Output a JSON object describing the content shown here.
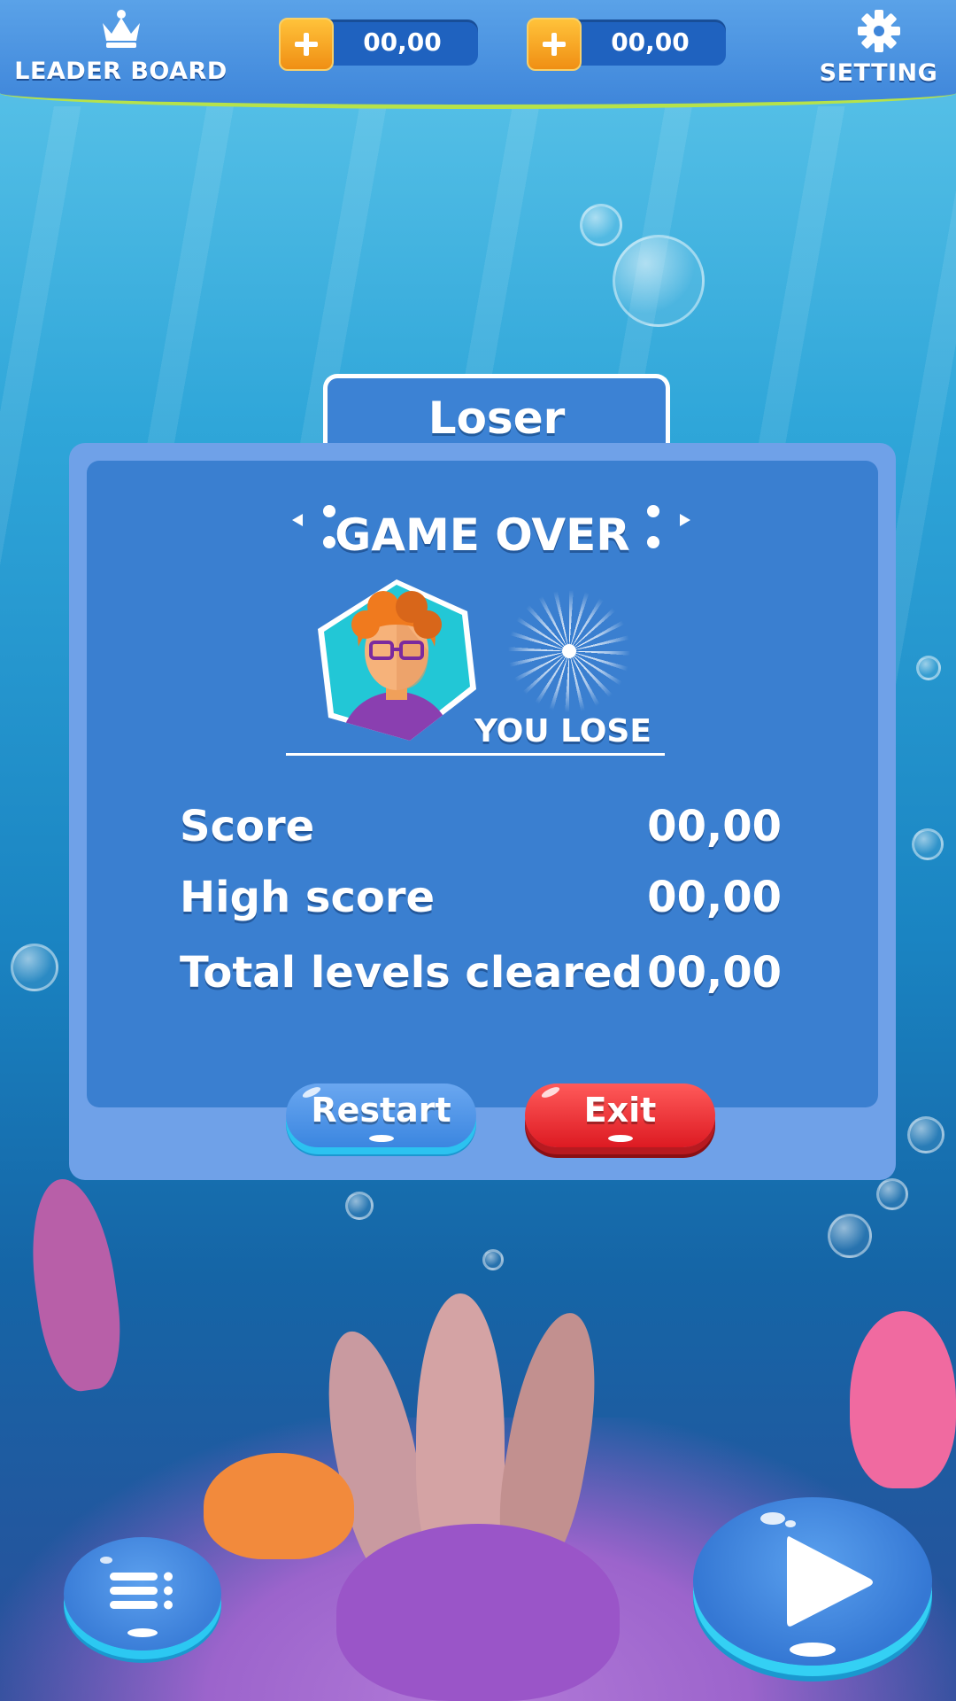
{
  "topbar": {
    "leaderboard_label": "LEADER BOARD",
    "currency_1": "00,00",
    "currency_2": "00,00",
    "setting_label": "SETTING"
  },
  "dialog": {
    "tab_title": "Loser",
    "heading": "GAME OVER",
    "result": "YOU LOSE",
    "stats": [
      {
        "label": "Score",
        "value": "00,00"
      },
      {
        "label": "High score",
        "value": "00,00"
      },
      {
        "label": "Total levels cleared",
        "value": "00,00"
      }
    ],
    "restart_label": "Restart",
    "exit_label": "Exit"
  },
  "icons": {
    "leaderboard": "crown-icon",
    "setting": "gear-icon",
    "add_currency": "plus-icon",
    "menu": "menu-list-icon",
    "play": "play-icon"
  },
  "colors": {
    "topbar": "#3f86da",
    "panel": "#3a7fd0",
    "restart": "#3b86e0",
    "exit": "#dd1a22",
    "plus": "#f5a21f"
  }
}
